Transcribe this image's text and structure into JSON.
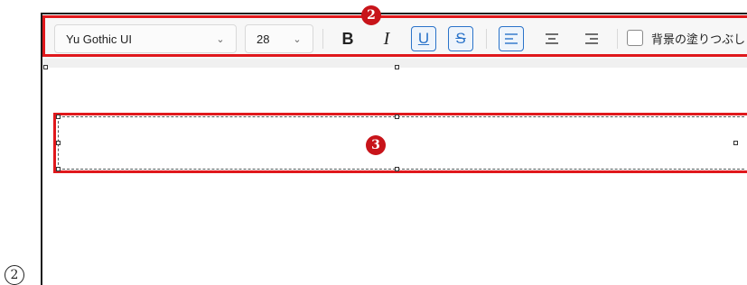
{
  "toolbar": {
    "font_family": "Yu Gothic UI",
    "font_size": "28",
    "bold_label": "B",
    "italic_label": "I",
    "underline_label": "U",
    "strike_label": "S",
    "background_fill_label": "背景の塗りつぶし"
  },
  "callouts": {
    "toolbar_number": "2",
    "textbox_number": "3",
    "step_marker": "2"
  },
  "colors": {
    "highlight": "#e0181c",
    "active_accent": "#2a73c9"
  }
}
